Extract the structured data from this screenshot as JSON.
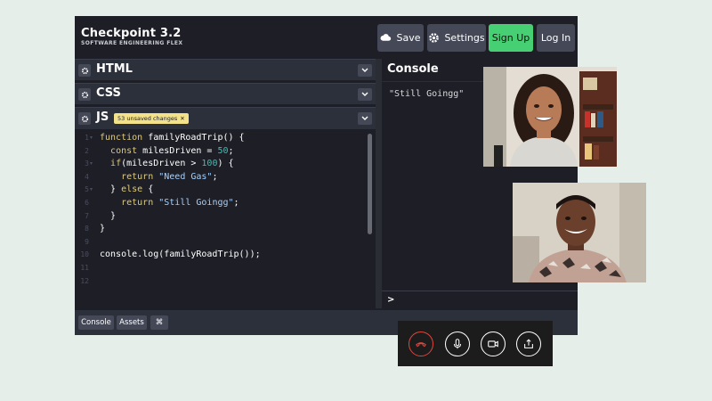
{
  "header": {
    "title": "Checkpoint 3.2",
    "subtitle": "SOFTWARE ENGINEERING FLEX",
    "save_label": "Save",
    "settings_label": "Settings",
    "signup_label": "Sign Up",
    "login_label": "Log In"
  },
  "panels": {
    "html_title": "HTML",
    "css_title": "CSS",
    "js_title": "JS",
    "js_badge": "53 unsaved changes",
    "js_badge_close": "✕"
  },
  "editor": {
    "line_numbers": [
      "1",
      "2",
      "3",
      "4",
      "5",
      "6",
      "7",
      "8",
      "9",
      "10",
      "11",
      "12"
    ],
    "lines": [
      "function familyRoadTrip() {",
      "  const milesDriven = 50;",
      "  if(milesDriven > 100) {",
      "    return \"Need Gas\";",
      "  } else {",
      "    return \"Still Goingg\";",
      "  }",
      "}",
      "",
      "console.log(familyRoadTrip());",
      "",
      ""
    ]
  },
  "console": {
    "title": "Console",
    "output": "\"Still Goingg\"",
    "prompt": ">"
  },
  "bottombar": {
    "console_label": "Console",
    "assets_label": "Assets",
    "shortcut_label": "⌘"
  },
  "icons": {
    "save": "cloud-icon",
    "settings": "gear-icon",
    "panel_settings": "gear-icon",
    "collapse": "chevron-down-icon",
    "hangup": "phone-hangup-icon",
    "mic": "microphone-icon",
    "camera": "video-camera-icon",
    "share": "share-screen-icon"
  },
  "colors": {
    "signup_bg": "#47cf73",
    "editor_bg": "#1e1f26",
    "badge_bg": "#f3e28a",
    "hangup": "#e0443b",
    "keyword": "#ddca7e",
    "number": "#2bc7b9",
    "string": "#a3d0ff"
  }
}
